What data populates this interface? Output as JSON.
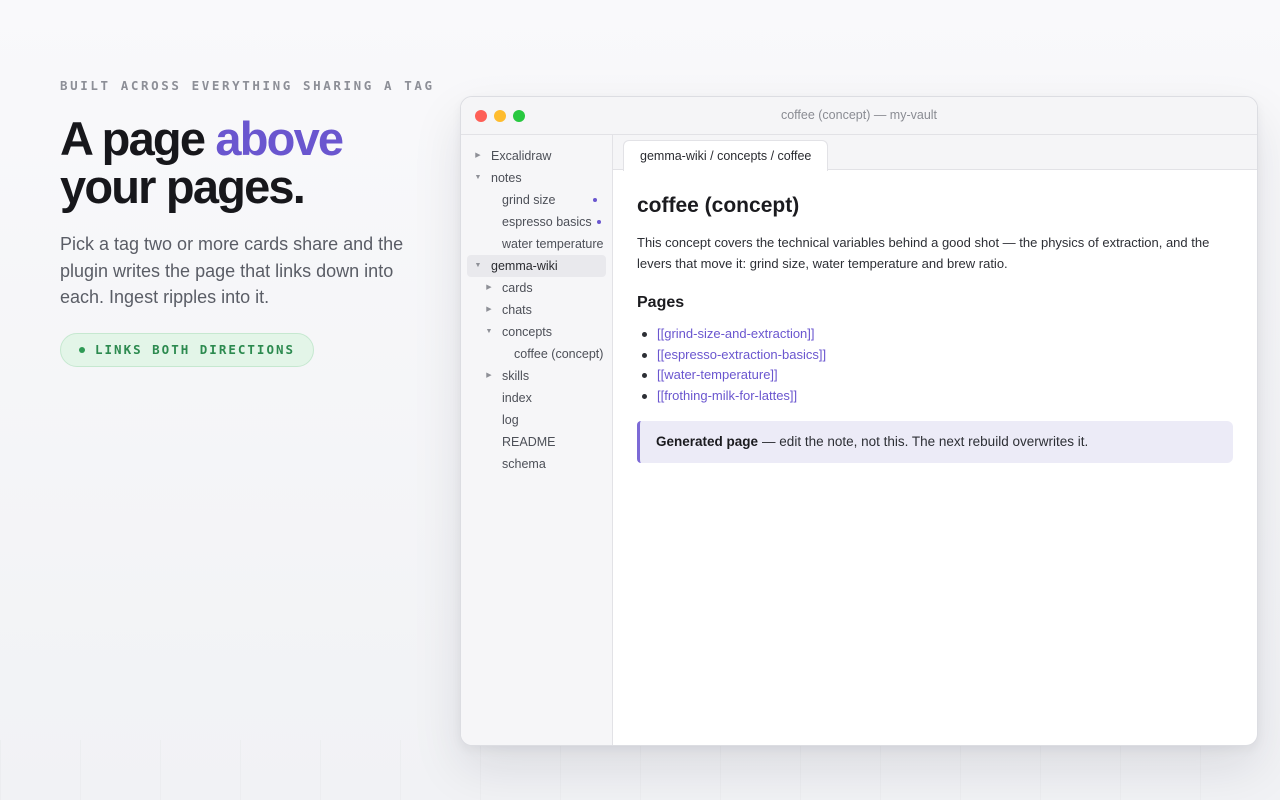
{
  "hero": {
    "eyebrow": "BUILT ACROSS EVERYTHING SHARING A TAG",
    "headline_part1": "A page ",
    "headline_accent": "above",
    "headline_part2": "your pages.",
    "description": "Pick a tag two or more cards share and the plugin writes the page that links down into each. Ingest ripples into it.",
    "pill_label": "LINKS BOTH DIRECTIONS"
  },
  "window": {
    "title": "coffee (concept) — my-vault"
  },
  "sidebar": {
    "items": [
      {
        "label": "Excalidraw",
        "caret": "collapsed"
      },
      {
        "label": "notes",
        "caret": "expanded"
      },
      {
        "label": "grind size",
        "marker": true
      },
      {
        "label": "espresso basics",
        "marker": true
      },
      {
        "label": "water temperature",
        "marker": true
      },
      {
        "label": "gemma-wiki",
        "caret": "expanded",
        "active": true
      },
      {
        "label": "cards",
        "caret": "collapsed"
      },
      {
        "label": "chats",
        "caret": "collapsed"
      },
      {
        "label": "concepts",
        "caret": "expanded"
      },
      {
        "label": "coffee (concept)"
      },
      {
        "label": "skills",
        "caret": "collapsed"
      },
      {
        "label": "index"
      },
      {
        "label": "log"
      },
      {
        "label": "README"
      },
      {
        "label": "schema"
      }
    ]
  },
  "tab": {
    "label": "gemma-wiki / concepts / coffee"
  },
  "document": {
    "title": "coffee (concept)",
    "intro": "This concept covers the technical variables behind a good shot — the physics of extraction, and the levers that move it: grind size, water temperature and brew ratio.",
    "pages_heading": "Pages",
    "links": [
      "[[grind-size-and-extraction]]",
      "[[espresso-extraction-basics]]",
      "[[water-temperature]]",
      "[[frothing-milk-for-lattes]]"
    ],
    "callout_bold": "Generated page",
    "callout_text": "— edit the note, not this. The next rebuild overwrites it."
  },
  "colors": {
    "accent": "#6a56cf",
    "pill_green": "#2c8a4f",
    "callout_bg": "#ecebf7"
  }
}
